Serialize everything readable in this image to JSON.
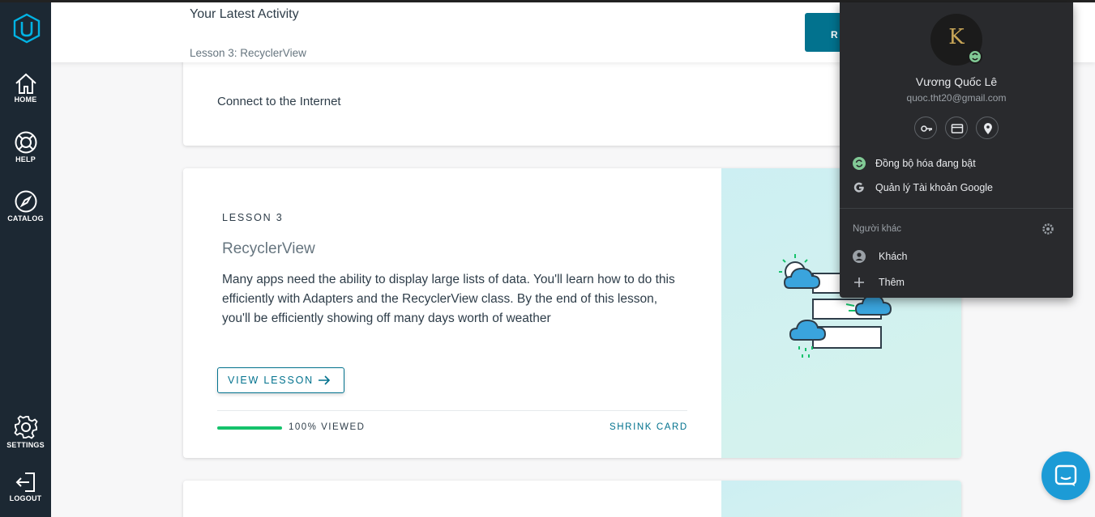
{
  "nav": {
    "home": "HOME",
    "help": "HELP",
    "catalog": "CATALOG",
    "settings": "SETTINGS",
    "logout": "LOGOUT"
  },
  "activity": {
    "title": "Your Latest Activity",
    "subtitle": "Lesson 3: RecyclerView",
    "resume_label": "R"
  },
  "card_prev": {
    "text": "Connect to the Internet"
  },
  "lesson": {
    "kicker": "LESSON 3",
    "title": "RecyclerView",
    "description": "Many apps need the ability to display large lists of data. You'll learn how to do this efficiently with Adapters and the RecyclerView class. By the end of this lesson, you'll be efficiently showing off many days worth of weather",
    "view_button": "VIEW LESSON",
    "progress_fraction": 1.0,
    "progress_label": "100% VIEWED",
    "shrink": "SHRINK CARD"
  },
  "profile": {
    "avatar_letter": "K",
    "name": "Vương Quốc Lê",
    "email": "quoc.tht20@gmail.com",
    "sync": "Đồng bộ hóa đang bật",
    "manage": "Quản lý Tài khoản Google",
    "others_label": "Người khác",
    "guest": "Khách",
    "add": "Thêm"
  },
  "colors": {
    "nav_bg": "#1c2833",
    "accent": "#02728e",
    "progress": "#15c26b",
    "chat": "#1c9bd6",
    "menu_bg": "#292a2d"
  }
}
